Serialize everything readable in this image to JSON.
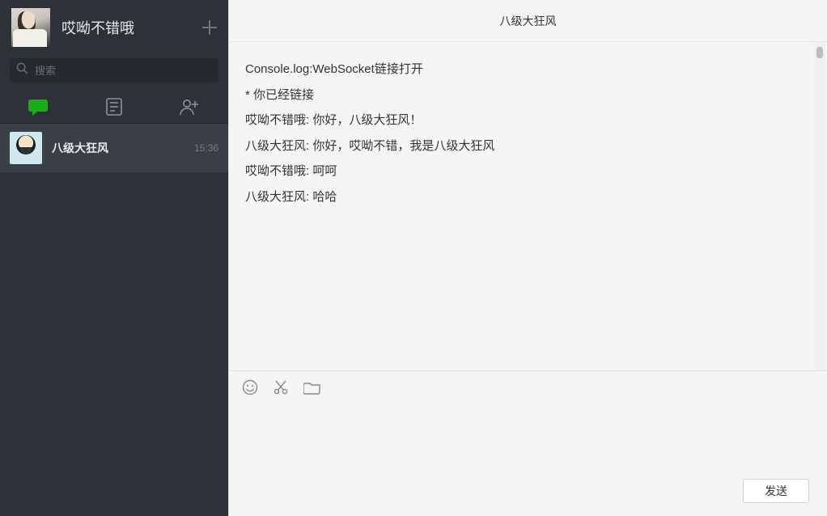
{
  "sidebar": {
    "profile_name": "哎呦不错哦",
    "search_placeholder": "搜索",
    "tabs": {
      "chats_icon": "chat-bubble-icon",
      "files_icon": "document-icon",
      "contacts_icon": "add-contact-icon"
    },
    "chats": [
      {
        "name": "八级大狂风",
        "time": "15:36",
        "active": true
      }
    ]
  },
  "chat": {
    "header_title": "八级大狂风",
    "messages": [
      "Console.log:WebSocket链接打开",
      "* 你已经链接",
      "哎呦不错哦: 你好，八级大狂风！",
      "八级大狂风: 你好，哎呦不错，我是八级大狂风",
      "哎呦不错哦: 呵呵",
      "八级大狂风: 哈哈"
    ],
    "compose_value": "",
    "send_label": "发送"
  }
}
